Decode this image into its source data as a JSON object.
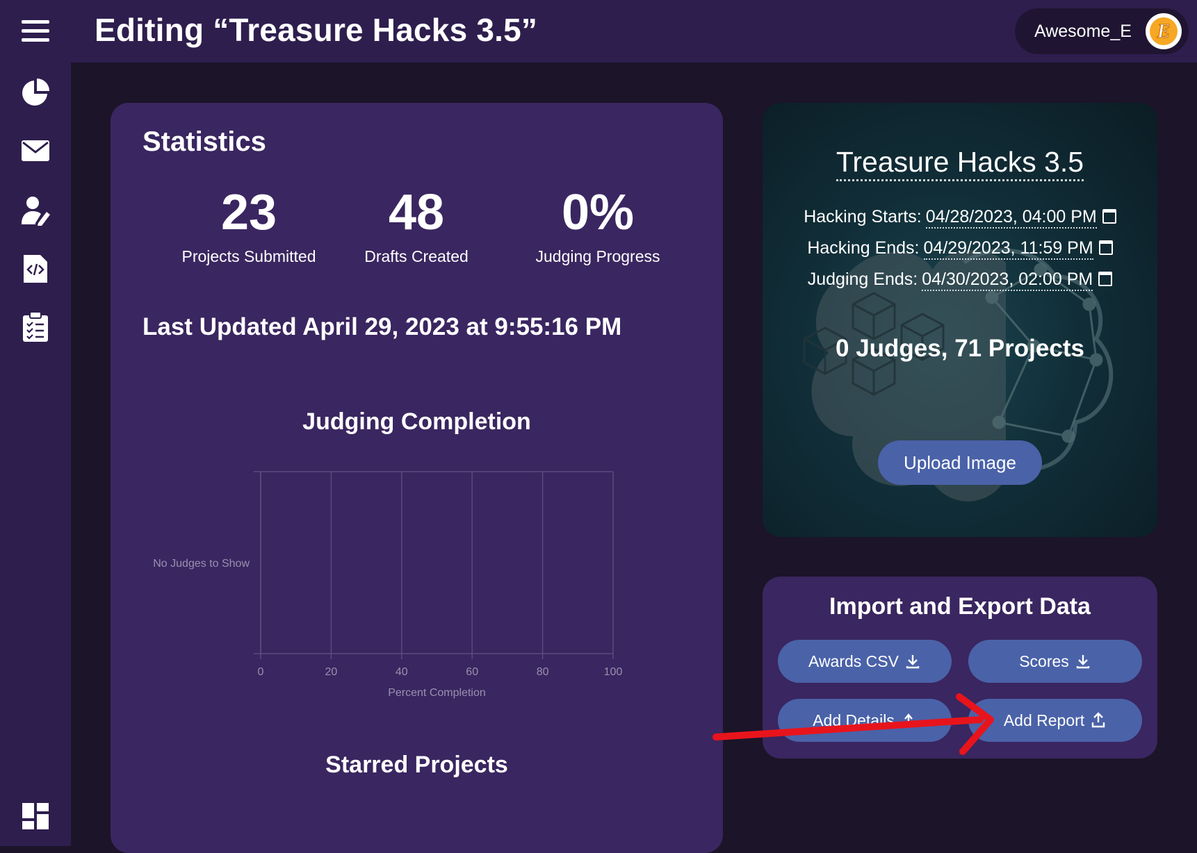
{
  "header": {
    "title": "Editing “Treasure Hacks 3.5”",
    "username": "Awesome_E",
    "avatar_letter": "E"
  },
  "sidebar": {
    "items": [
      {
        "icon": "menu-icon"
      },
      {
        "icon": "pie-chart-icon"
      },
      {
        "icon": "mail-icon"
      },
      {
        "icon": "user-edit-icon"
      },
      {
        "icon": "code-file-icon"
      },
      {
        "icon": "clipboard-list-icon"
      },
      {
        "icon": "dashboard-icon"
      }
    ]
  },
  "statistics": {
    "title": "Statistics",
    "projects_submitted": {
      "value": "23",
      "label": "Projects Submitted"
    },
    "drafts_created": {
      "value": "48",
      "label": "Drafts Created"
    },
    "judging_progress": {
      "value": "0%",
      "label": "Judging Progress"
    },
    "last_updated": "Last Updated April 29, 2023 at 9:55:16 PM",
    "starred_title": "Starred Projects"
  },
  "chart_data": {
    "type": "bar",
    "orientation": "horizontal",
    "title": "Judging Completion",
    "xlabel": "Percent Completion",
    "ylabel": "",
    "xlim": [
      0,
      100
    ],
    "x_ticks": [
      "0",
      "20",
      "40",
      "60",
      "80",
      "100"
    ],
    "categories": [],
    "values": [],
    "empty_message": "No Judges to Show",
    "grid": true
  },
  "event": {
    "name": "Treasure Hacks 3.5",
    "hacking_starts_label": "Hacking Starts:",
    "hacking_starts_value": "04/28/2023, 04:00 PM",
    "hacking_ends_label": "Hacking Ends:",
    "hacking_ends_value": "04/29/2023, 11:59 PM",
    "judging_ends_label": "Judging Ends:",
    "judging_ends_value": "04/30/2023, 02:00 PM",
    "summary": "0 Judges, 71 Projects",
    "upload_label": "Upload Image"
  },
  "import_export": {
    "title": "Import and Export Data",
    "awards_csv": "Awards CSV",
    "scores": "Scores",
    "add_details": "Add Details",
    "add_report": "Add Report"
  },
  "colors": {
    "page_bg": "#1c1428",
    "panel": "#3a2660",
    "bar": "#2e1e4e",
    "button": "#4a62a8",
    "annotation_arrow": "#e8141c"
  }
}
